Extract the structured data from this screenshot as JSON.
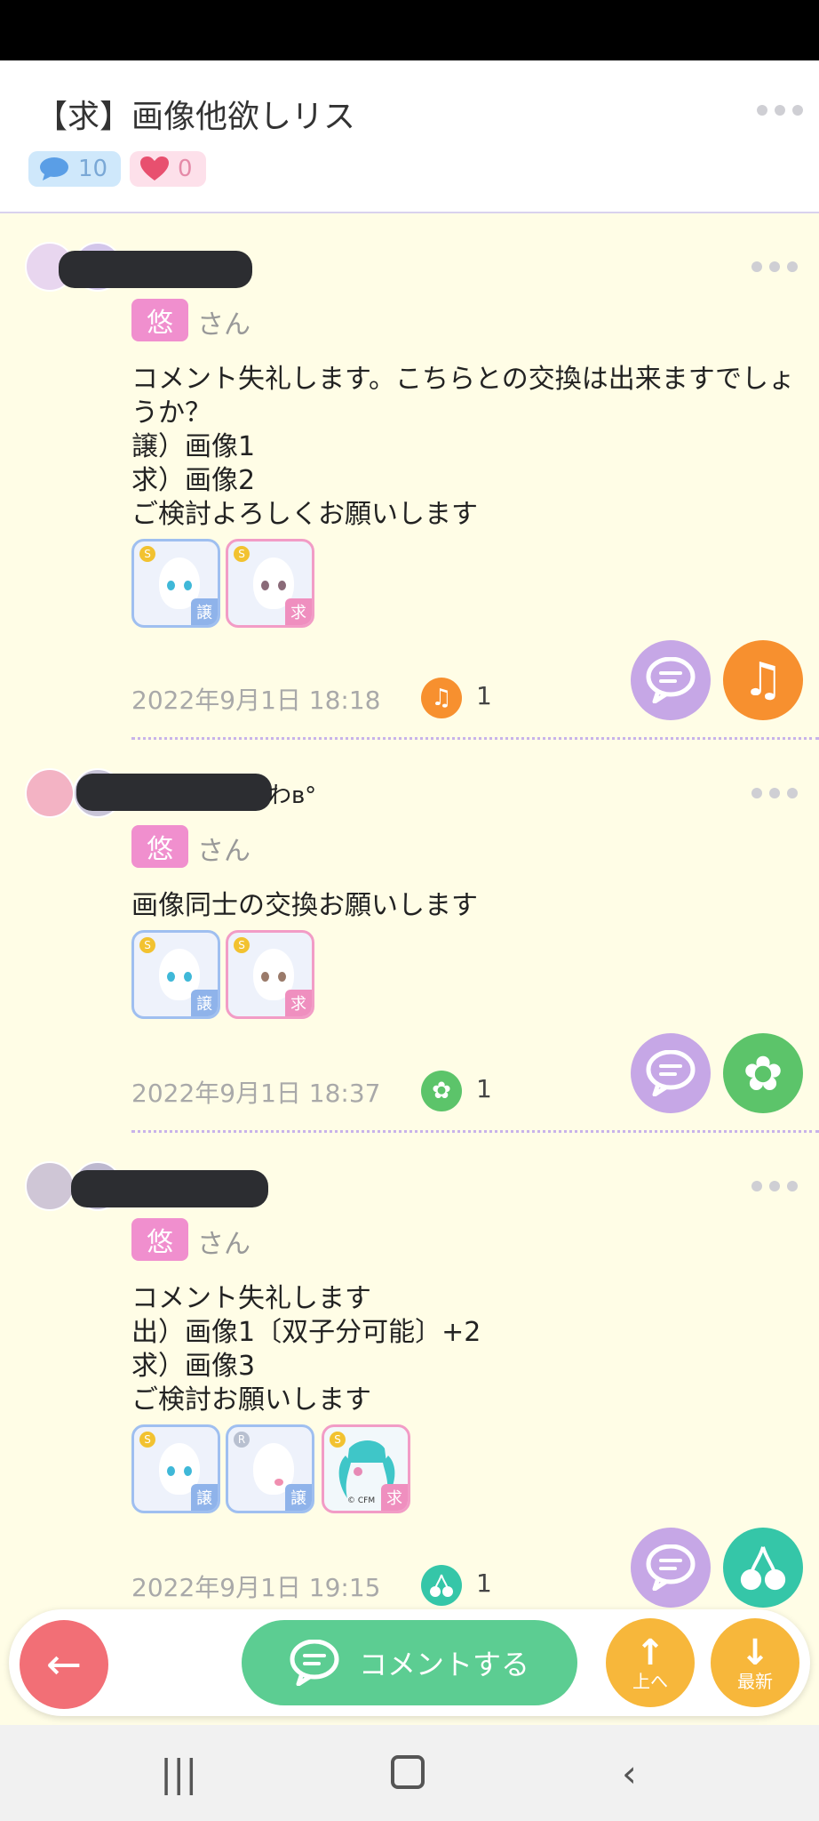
{
  "header": {
    "title": "【求】画像他欲しリス",
    "comment_count": "10",
    "like_count": "0"
  },
  "posts": [
    {
      "name_fragment": "",
      "tag": "悠",
      "suffix": "さん",
      "lines": [
        "コメント失礼します。こちらとの交換は出来ますでしょ",
        "うか？",
        "譲）画像1",
        "求）画像2",
        "ご検討よろしくお願いします"
      ],
      "items": [
        {
          "rank": "S",
          "label": "譲"
        },
        {
          "rank": "S",
          "label": "求"
        }
      ],
      "date": "2022年9月1日 18:18",
      "reaction_count": "1",
      "reaction_icon": "music-note-icon",
      "accent": "#f7902f"
    },
    {
      "name_fragment": "わʙ°",
      "tag": "悠",
      "suffix": "さん",
      "lines": [
        "画像同士の交換お願いします"
      ],
      "items": [
        {
          "rank": "S",
          "label": "譲"
        },
        {
          "rank": "S",
          "label": "求"
        }
      ],
      "date": "2022年9月1日 18:37",
      "reaction_count": "1",
      "reaction_icon": "flower-icon",
      "accent": "#5cc46a"
    },
    {
      "name_fragment": "",
      "tag": "悠",
      "suffix": "さん",
      "lines": [
        "コメント失礼します",
        "出）画像1〔双子分可能〕+2",
        "求）画像3",
        "ご検討お願いします"
      ],
      "items": [
        {
          "rank": "S",
          "label": "譲"
        },
        {
          "rank": "R",
          "label": "譲"
        },
        {
          "rank": "S",
          "label": "求",
          "watermark": "© CFM"
        }
      ],
      "date": "2022年9月1日 19:15",
      "reaction_count": "1",
      "reaction_icon": "cherry-icon",
      "accent": "#35c6a8"
    }
  ],
  "bottom_bar": {
    "comment_label": "コメントする",
    "up_label": "上へ",
    "latest_label": "最新"
  }
}
